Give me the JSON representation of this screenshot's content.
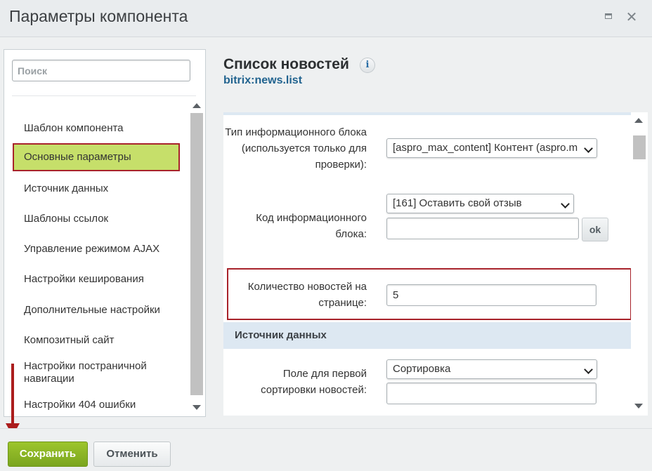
{
  "window": {
    "title": "Параметры компонента",
    "max_icon": "maximize-icon",
    "close_icon": "close-icon"
  },
  "sidebar": {
    "search_placeholder": "Поиск",
    "items": [
      {
        "label": "Шаблон компонента"
      },
      {
        "label": "Основные параметры",
        "active": true
      },
      {
        "label": "Источник данных"
      },
      {
        "label": "Шаблоны ссылок"
      },
      {
        "label": "Управление режимом AJAX"
      },
      {
        "label": "Настройки кеширования"
      },
      {
        "label": "Дополнительные настройки"
      },
      {
        "label": "Композитный сайт"
      },
      {
        "label": "Настройки постраничной навигации"
      },
      {
        "label": "Настройки 404 ошибки"
      }
    ]
  },
  "component": {
    "title": "Список новостей",
    "code": "bitrix:news.list",
    "info_icon": "info-icon"
  },
  "params": {
    "iblock_type": {
      "label": "Тип информационного блока (используется только для проверки):",
      "value": "[aspro_max_content] Контент (aspro.m"
    },
    "iblock_code": {
      "label": "Код информационного блока:",
      "value": "[161] Оставить свой отзыв",
      "input_value": "",
      "ok_label": "ok"
    },
    "news_count": {
      "label": "Количество новостей на странице:",
      "value": "5"
    },
    "section_title": "Источник данных",
    "sort_field": {
      "label": "Поле для первой сортировки новостей:",
      "value": "Сортировка",
      "input_value": ""
    }
  },
  "footer": {
    "save_label": "Сохранить",
    "cancel_label": "Отменить"
  },
  "colors": {
    "save_button": "#8cb526",
    "active_item": "#c6df6a",
    "highlight_border": "#a8232b",
    "link": "#21638f"
  }
}
